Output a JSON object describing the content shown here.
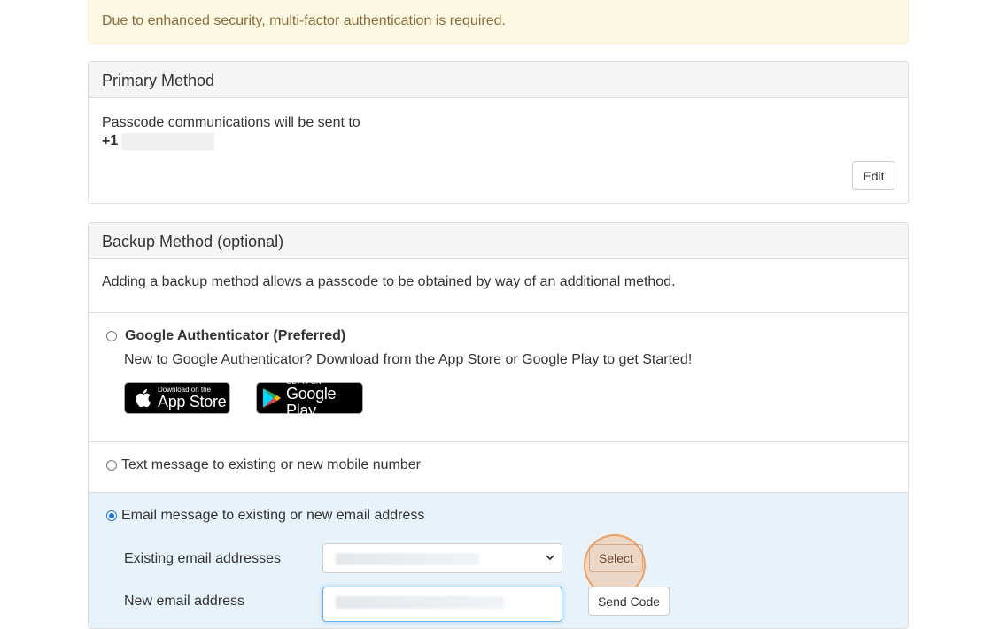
{
  "alert": {
    "text": "Due to enhanced security, multi-factor authentication is required."
  },
  "primary": {
    "heading": "Primary Method",
    "line1": "Passcode communications will be sent to",
    "phone_prefix": "+1",
    "edit_label": "Edit"
  },
  "backup": {
    "heading": "Backup Method (optional)",
    "intro": "Adding a backup method allows a passcode to be obtained by way of an additional method.",
    "options": [
      {
        "label": "Google Authenticator (Preferred)",
        "checked": false,
        "description": "New to Google Authenticator? Download from the App Store or Google Play to get Started!",
        "badges": {
          "appstore_small": "Download on the",
          "appstore_big": "App Store",
          "gplay_small": "GET IT ON",
          "gplay_big": "Google Play"
        }
      },
      {
        "label": "Text message to existing or new mobile number",
        "checked": false
      },
      {
        "label": "Email message to existing or new email address",
        "checked": true,
        "existing_label": "Existing email addresses",
        "new_label": "New email address",
        "select_label": "Select",
        "send_label": "Send Code"
      }
    ]
  },
  "colors": {
    "alert_bg": "#fdf8e4",
    "alert_text": "#8a6d3b",
    "selected_option_bg": "#e8f2fb",
    "highlight": "#f4a460"
  }
}
